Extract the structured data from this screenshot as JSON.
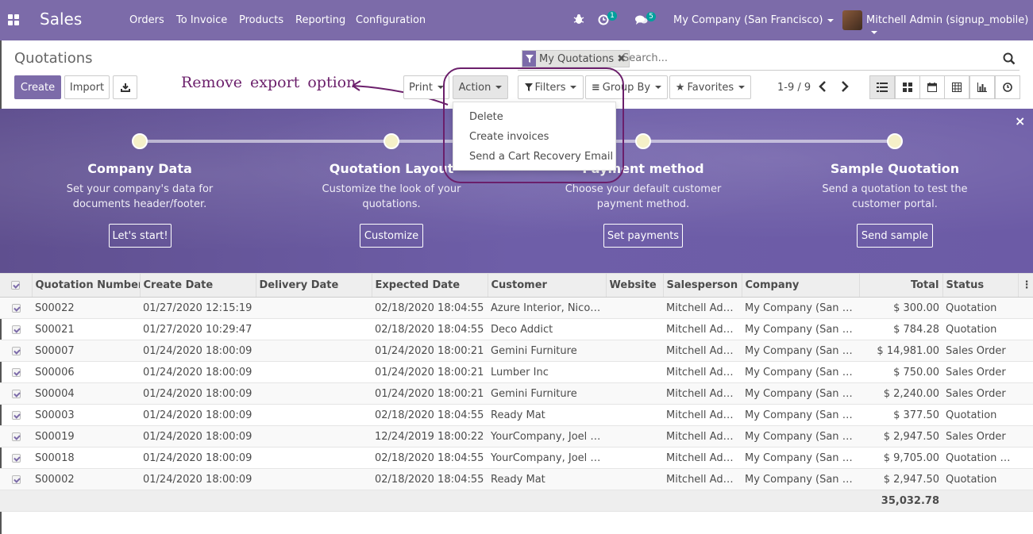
{
  "navbar": {
    "brand": "Sales",
    "menu": [
      "Orders",
      "To Invoice",
      "Products",
      "Reporting",
      "Configuration"
    ],
    "activity_count": "1",
    "messages_count": "5",
    "company": "My Company (San Francisco)",
    "user": "Mitchell Admin (signup_mobile)"
  },
  "control_panel": {
    "title": "Quotations",
    "create_label": "Create",
    "import_label": "Import",
    "print_label": "Print",
    "action_label": "Action",
    "filters_label": "Filters",
    "groupby_label": "Group By",
    "favorites_label": "Favorites",
    "facet_label": "My Quotations",
    "search_placeholder": "Search...",
    "pager": "1-9 / 9"
  },
  "action_menu": [
    "Delete",
    "Create invoices",
    "Send a Cart Recovery Email"
  ],
  "annotation": "Remove export option",
  "banner": {
    "steps": [
      {
        "title": "Company Data",
        "desc1": "Set your company's data for",
        "desc2": "documents header/footer.",
        "button": "Let's start!"
      },
      {
        "title": "Quotation Layout",
        "desc1": "Customize the look of your",
        "desc2": "quotations.",
        "button": "Customize"
      },
      {
        "title": "Payment method",
        "desc1": "Choose your default customer",
        "desc2": "payment method.",
        "button": "Set payments"
      },
      {
        "title": "Sample Quotation",
        "desc1": "Send a quotation to test the",
        "desc2": "customer portal.",
        "button": "Send sample"
      }
    ],
    "close": "×"
  },
  "table": {
    "columns": [
      "Quotation Number",
      "Create Date",
      "Delivery Date",
      "Expected Date",
      "Customer",
      "Website",
      "Salesperson",
      "Company",
      "Total",
      "Status"
    ],
    "rows": [
      {
        "number": "S00022",
        "create": "01/27/2020 12:15:19",
        "delivery": "",
        "expected": "02/18/2020 18:04:55",
        "customer": "Azure Interior, Nicole Ford",
        "website": "",
        "salesperson": "Mitchell Admin",
        "company": "My Company (San Francisco)",
        "total": "$ 300.00",
        "status": "Quotation"
      },
      {
        "number": "S00021",
        "create": "01/27/2020 10:29:47",
        "delivery": "",
        "expected": "02/18/2020 18:04:55",
        "customer": "Deco Addict",
        "website": "",
        "salesperson": "Mitchell Admin",
        "company": "My Company (San Francisco)",
        "total": "$ 784.28",
        "status": "Quotation"
      },
      {
        "number": "S00007",
        "create": "01/24/2020 18:00:09",
        "delivery": "",
        "expected": "01/24/2020 18:00:21",
        "customer": "Gemini Furniture",
        "website": "",
        "salesperson": "Mitchell Admin",
        "company": "My Company (San Francisco)",
        "total": "$ 14,981.00",
        "status": "Sales Order"
      },
      {
        "number": "S00006",
        "create": "01/24/2020 18:00:09",
        "delivery": "",
        "expected": "01/24/2020 18:00:21",
        "customer": "Lumber Inc",
        "website": "",
        "salesperson": "Mitchell Admin",
        "company": "My Company (San Francisco)",
        "total": "$ 750.00",
        "status": "Sales Order"
      },
      {
        "number": "S00004",
        "create": "01/24/2020 18:00:09",
        "delivery": "",
        "expected": "01/24/2020 18:00:21",
        "customer": "Gemini Furniture",
        "website": "",
        "salesperson": "Mitchell Admin",
        "company": "My Company (San Francisco)",
        "total": "$ 2,240.00",
        "status": "Sales Order"
      },
      {
        "number": "S00003",
        "create": "01/24/2020 18:00:09",
        "delivery": "",
        "expected": "02/18/2020 18:04:55",
        "customer": "Ready Mat",
        "website": "",
        "salesperson": "Mitchell Admin",
        "company": "My Company (San Francisco)",
        "total": "$ 377.50",
        "status": "Quotation"
      },
      {
        "number": "S00019",
        "create": "01/24/2020 18:00:09",
        "delivery": "",
        "expected": "12/24/2019 18:00:22",
        "customer": "YourCompany, Joel Willis",
        "website": "",
        "salesperson": "Mitchell Admin",
        "company": "My Company (San Francisco)",
        "total": "$ 2,947.50",
        "status": "Sales Order"
      },
      {
        "number": "S00018",
        "create": "01/24/2020 18:00:09",
        "delivery": "",
        "expected": "02/18/2020 18:04:55",
        "customer": "YourCompany, Joel Willis",
        "website": "",
        "salesperson": "Mitchell Admin",
        "company": "My Company (San Francisco)",
        "total": "$ 9,705.00",
        "status": "Quotation Sent"
      },
      {
        "number": "S00002",
        "create": "01/24/2020 18:00:09",
        "delivery": "",
        "expected": "02/18/2020 18:04:55",
        "customer": "Ready Mat",
        "website": "",
        "salesperson": "Mitchell Admin",
        "company": "My Company (San Francisco)",
        "total": "$ 2,947.50",
        "status": "Quotation"
      }
    ],
    "footer_total": "35,032.78"
  },
  "colors": {
    "brand": "#7c6ba9",
    "annotation": "#6b1f6b"
  },
  "icons": [
    "apps-icon",
    "bug-icon",
    "activity-icon",
    "chat-icon",
    "download-icon",
    "filter-icon",
    "search-icon",
    "list-view-icon",
    "kanban-view-icon",
    "calendar-view-icon",
    "pivot-view-icon",
    "graph-view-icon",
    "activity-view-icon"
  ]
}
